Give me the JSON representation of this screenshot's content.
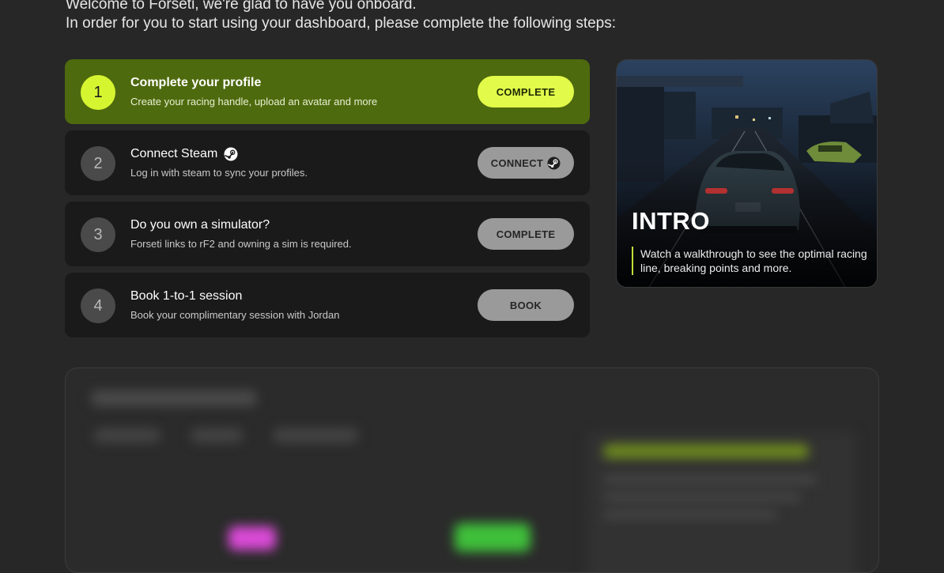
{
  "welcome": {
    "line1": "Welcome to Forseti, we're glad to have you onboard.",
    "line2": "In order for you to start using your dashboard, please complete the following steps:"
  },
  "steps": [
    {
      "number": "1",
      "title": "Complete your profile",
      "description": "Create your racing handle, upload an avatar and more",
      "button": "COMPLETE",
      "active": true
    },
    {
      "number": "2",
      "title": "Connect Steam",
      "title_icon": "steam-icon",
      "description": "Log in with steam to sync your profiles.",
      "button": "CONNECT",
      "button_icon": "steam-icon",
      "active": false
    },
    {
      "number": "3",
      "title": "Do you own a simulator?",
      "description": "Forseti links to rF2 and owning a sim is required.",
      "button": "COMPLETE",
      "active": false
    },
    {
      "number": "4",
      "title": "Book 1-to-1 session",
      "description": "Book your complimentary session with Jordan",
      "button": "BOOK",
      "active": false
    }
  ],
  "intro_card": {
    "heading": "INTRO",
    "description": "Watch a walkthrough to see the optimal racing line, breaking points and more."
  },
  "colors": {
    "background": "#272727",
    "card": "#1a1a1a",
    "active_card": "#4e6a0e",
    "accent": "#e2fb4a",
    "button_inactive": "#9a9a9a"
  }
}
